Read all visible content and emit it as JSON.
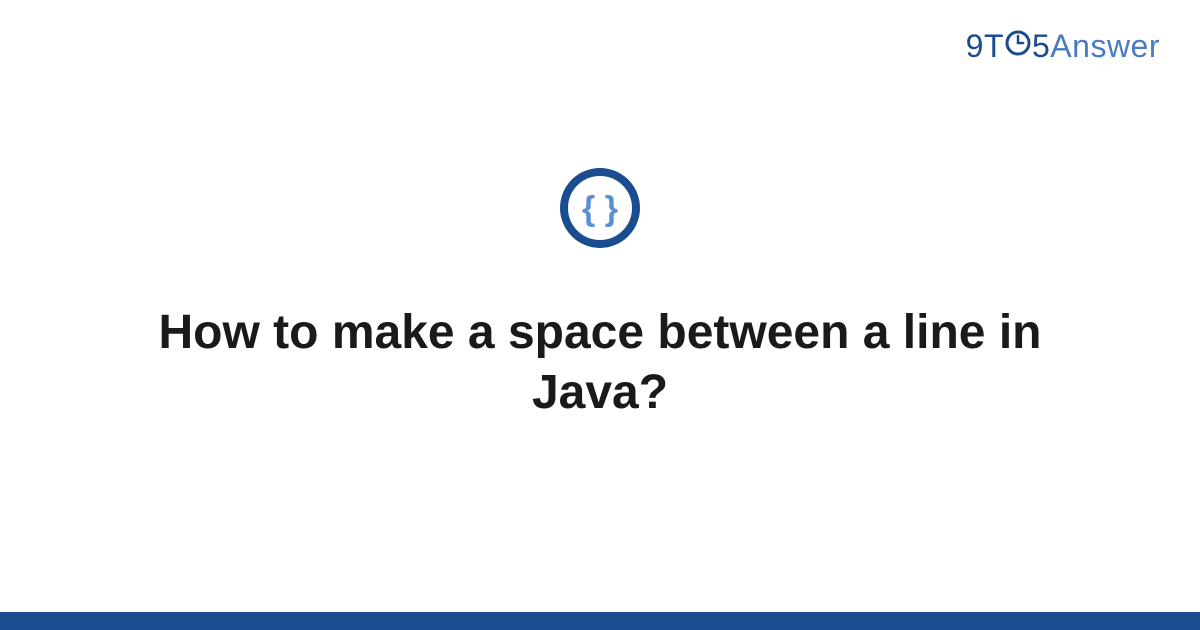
{
  "logo": {
    "part1": "9",
    "part2": "T",
    "part3": "5",
    "part4": "Answer"
  },
  "badge": {
    "symbol": "{ }",
    "ring_color": "#1a4d8f",
    "inner_color": "#5a8fd4"
  },
  "question": {
    "title": "How to make a space between a line in Java?"
  },
  "colors": {
    "brand_dark": "#1a4d8f",
    "brand_mid": "#4a7bc0",
    "bottom_bar": "#1a4d8f"
  }
}
